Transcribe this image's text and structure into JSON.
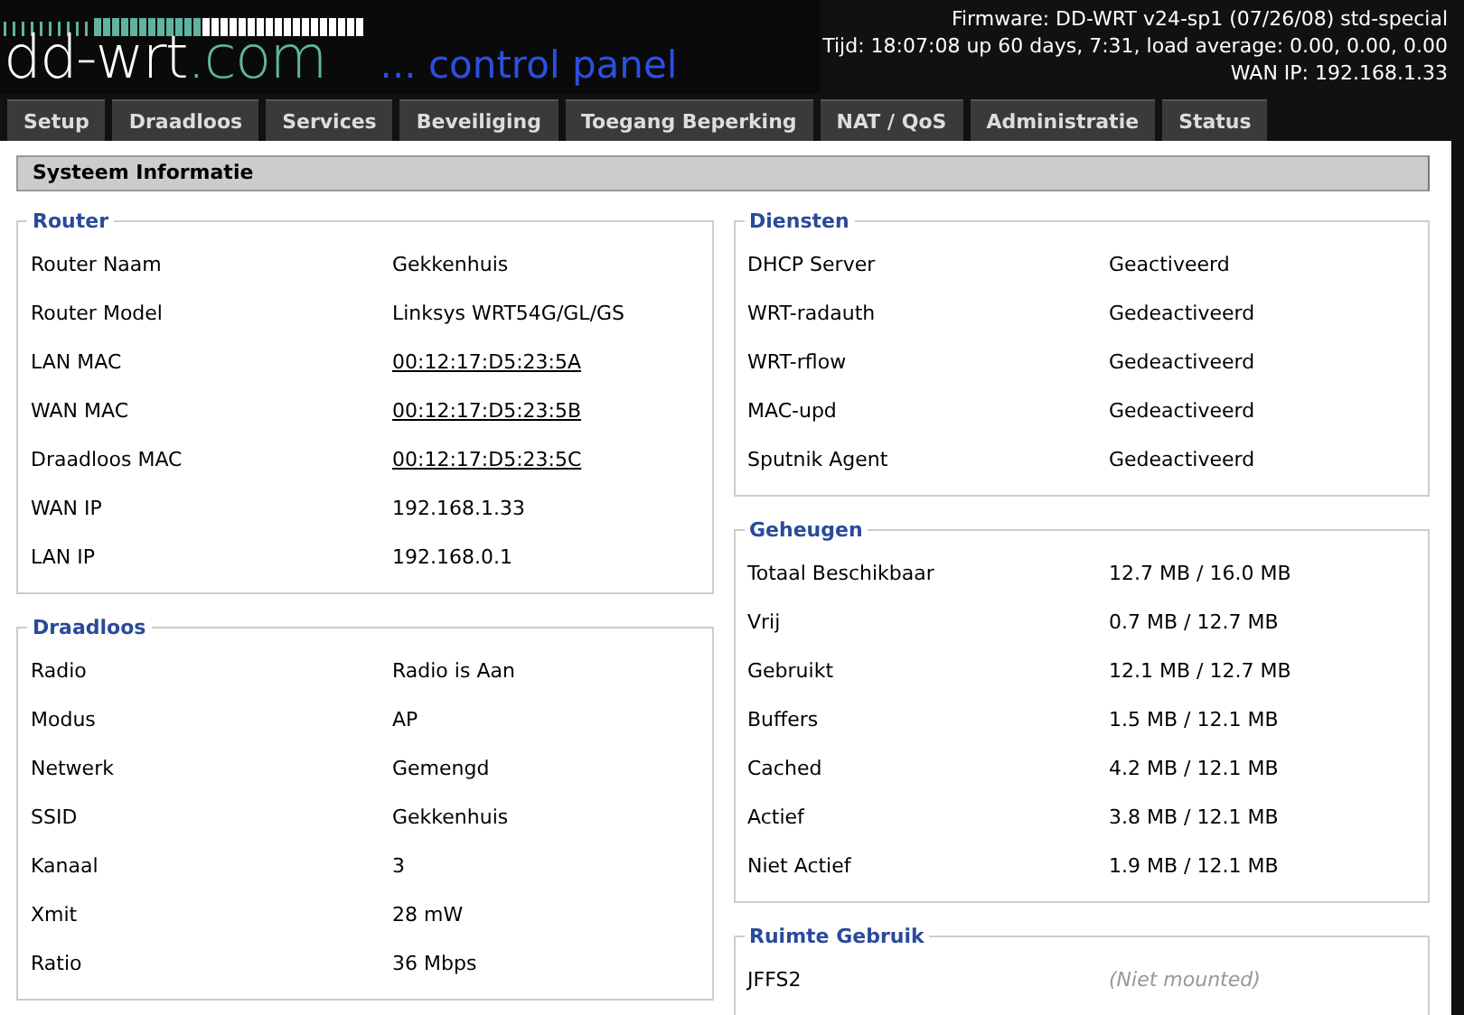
{
  "header": {
    "logo_name": "dd-wrt",
    "logo_suffix": ".com",
    "tagline": "... control panel",
    "firmware": "Firmware: DD-WRT v24-sp1 (07/26/08) std-special",
    "uptime": "Tijd: 18:07:08 up 60 days, 7:31, load average: 0.00, 0.00, 0.00",
    "wan_ip": "WAN IP: 192.168.1.33"
  },
  "tabs": [
    {
      "label": "Setup",
      "selected": false
    },
    {
      "label": "Draadloos",
      "selected": false
    },
    {
      "label": "Services",
      "selected": false
    },
    {
      "label": "Beveiliging",
      "selected": false
    },
    {
      "label": "Toegang Beperking",
      "selected": false
    },
    {
      "label": "NAT / QoS",
      "selected": false
    },
    {
      "label": "Administratie",
      "selected": false
    },
    {
      "label": "Status",
      "selected": false
    }
  ],
  "page_title": "Systeem Informatie",
  "columns": [
    [
      {
        "legend": "Router",
        "rows": [
          {
            "label": "Router Naam",
            "value": "Gekkenhuis",
            "kind": "text"
          },
          {
            "label": "Router Model",
            "value": "Linksys WRT54G/GL/GS",
            "kind": "text"
          },
          {
            "label": "LAN MAC",
            "value": "00:12:17:D5:23:5A",
            "kind": "link"
          },
          {
            "label": "WAN MAC",
            "value": "00:12:17:D5:23:5B",
            "kind": "link"
          },
          {
            "label": "Draadloos MAC",
            "value": "00:12:17:D5:23:5C",
            "kind": "link"
          },
          {
            "label": "WAN IP",
            "value": "192.168.1.33",
            "kind": "text"
          },
          {
            "label": "LAN IP",
            "value": "192.168.0.1",
            "kind": "text"
          }
        ]
      },
      {
        "legend": "Draadloos",
        "rows": [
          {
            "label": "Radio",
            "value": "Radio is Aan",
            "kind": "text"
          },
          {
            "label": "Modus",
            "value": "AP",
            "kind": "text"
          },
          {
            "label": "Netwerk",
            "value": "Gemengd",
            "kind": "text"
          },
          {
            "label": "SSID",
            "value": "Gekkenhuis",
            "kind": "text"
          },
          {
            "label": "Kanaal",
            "value": "3",
            "kind": "text"
          },
          {
            "label": "Xmit",
            "value": "28 mW",
            "kind": "text"
          },
          {
            "label": "Ratio",
            "value": "36 Mbps",
            "kind": "text"
          }
        ]
      }
    ],
    [
      {
        "legend": "Diensten",
        "rows": [
          {
            "label": "DHCP Server",
            "value": "Geactiveerd",
            "kind": "text"
          },
          {
            "label": "WRT-radauth",
            "value": "Gedeactiveerd",
            "kind": "text"
          },
          {
            "label": "WRT-rflow",
            "value": "Gedeactiveerd",
            "kind": "text"
          },
          {
            "label": "MAC-upd",
            "value": "Gedeactiveerd",
            "kind": "text"
          },
          {
            "label": "Sputnik Agent",
            "value": "Gedeactiveerd",
            "kind": "text"
          }
        ]
      },
      {
        "legend": "Geheugen",
        "rows": [
          {
            "label": "Totaal Beschikbaar",
            "value": "12.7 MB / 16.0 MB",
            "kind": "text"
          },
          {
            "label": "Vrij",
            "value": "0.7 MB / 12.7 MB",
            "kind": "text"
          },
          {
            "label": "Gebruikt",
            "value": "12.1 MB / 12.7 MB",
            "kind": "text"
          },
          {
            "label": "Buffers",
            "value": "1.5 MB / 12.1 MB",
            "kind": "text"
          },
          {
            "label": "Cached",
            "value": "4.2 MB / 12.1 MB",
            "kind": "text"
          },
          {
            "label": "Actief",
            "value": "3.8 MB / 12.1 MB",
            "kind": "text"
          },
          {
            "label": "Niet Actief",
            "value": "1.9 MB / 12.1 MB",
            "kind": "text"
          }
        ]
      },
      {
        "legend": "Ruimte Gebruik",
        "rows": [
          {
            "label": "JFFS2",
            "value": "(Niet mounted)",
            "kind": "muted"
          }
        ]
      }
    ]
  ]
}
